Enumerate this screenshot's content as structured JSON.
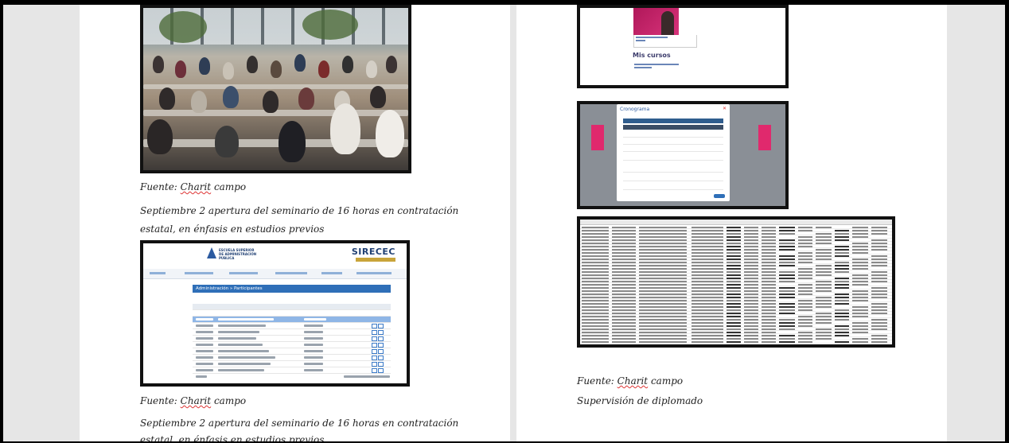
{
  "document": {
    "left_page": {
      "caption1_source_prefix": "Fuente: ",
      "caption1_source_name": "Charit",
      "caption1_source_suffix": " campo",
      "caption1_line1": "Septiembre 2 apertura del seminario de 16 horas en contratación",
      "caption1_line2": "estatal, en énfasis en estudios previos",
      "caption2_source_prefix": "Fuente: ",
      "caption2_source_name": "Charit",
      "caption2_source_suffix": " campo",
      "caption2_line1": "Septiembre 2 apertura del seminario de 16 horas en contratación",
      "caption2_line2": "estatal, en énfasis en estudios previos"
    },
    "right_page": {
      "caption_source_prefix": "Fuente: ",
      "caption_source_name": "Charit",
      "caption_source_suffix": " campo",
      "caption_line1": "Supervisión de diplomado"
    }
  },
  "portal_screenshot": {
    "logo_text": [
      "ESCUELA SUPERIOR",
      "DE ADMINISTRACIÓN",
      "PÚBLICA"
    ],
    "brand": "SIRECEC",
    "panel_title": "Administración » Participantes"
  },
  "courses_screenshot": {
    "heading": "Mis cursos"
  },
  "modal_screenshot": {
    "title": "Cronograma"
  },
  "colors": {
    "frame": "#111111",
    "viewer_bg": "#e6e6e6",
    "spell_underline": "#dd3333",
    "portal_blue": "#2f6fb8",
    "course_pink": "#d8337a"
  }
}
